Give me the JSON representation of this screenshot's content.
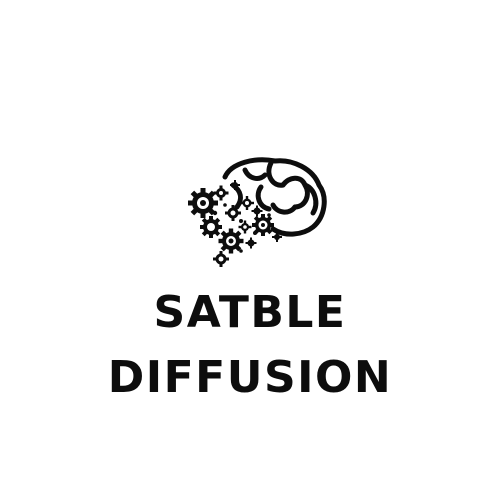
{
  "logo": {
    "icon": "brain-gears-icon",
    "line1": "SATBLE",
    "line2": "DIFFUSION"
  },
  "colors": {
    "background": "#ffffff",
    "ink": "#0d0d0d"
  }
}
